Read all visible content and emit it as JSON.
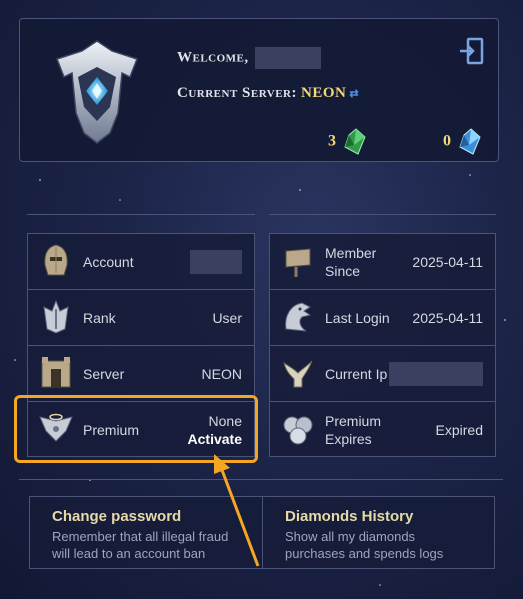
{
  "header": {
    "welcome_label": "Welcome,",
    "server_label": "Current Server:",
    "server_name": "NEON",
    "green_diamonds": "3",
    "blue_diamonds": "0"
  },
  "left_rows": [
    {
      "label": "Account",
      "value": ""
    },
    {
      "label": "Rank",
      "value": "User"
    },
    {
      "label": "Server",
      "value": "NEON"
    },
    {
      "label": "Premium",
      "value": "None",
      "action": "Activate"
    }
  ],
  "right_rows": [
    {
      "label": "Member Since",
      "value": "2025-04-11"
    },
    {
      "label": "Last Login",
      "value": "2025-04-11"
    },
    {
      "label": "Current Ip",
      "value": ""
    },
    {
      "label": "Premium Expires",
      "value": "Expired"
    }
  ],
  "actions": {
    "change_password": {
      "title": "Change password",
      "desc": "Remember that all illegal fraud will lead to an account ban"
    },
    "diamonds_history": {
      "title": "Diamonds History",
      "desc": "Show all my diamonds purchases and spends logs"
    }
  },
  "colors": {
    "highlight": "#f5a623",
    "gold_text": "#f3d878",
    "panel_border": "#4a5478"
  }
}
